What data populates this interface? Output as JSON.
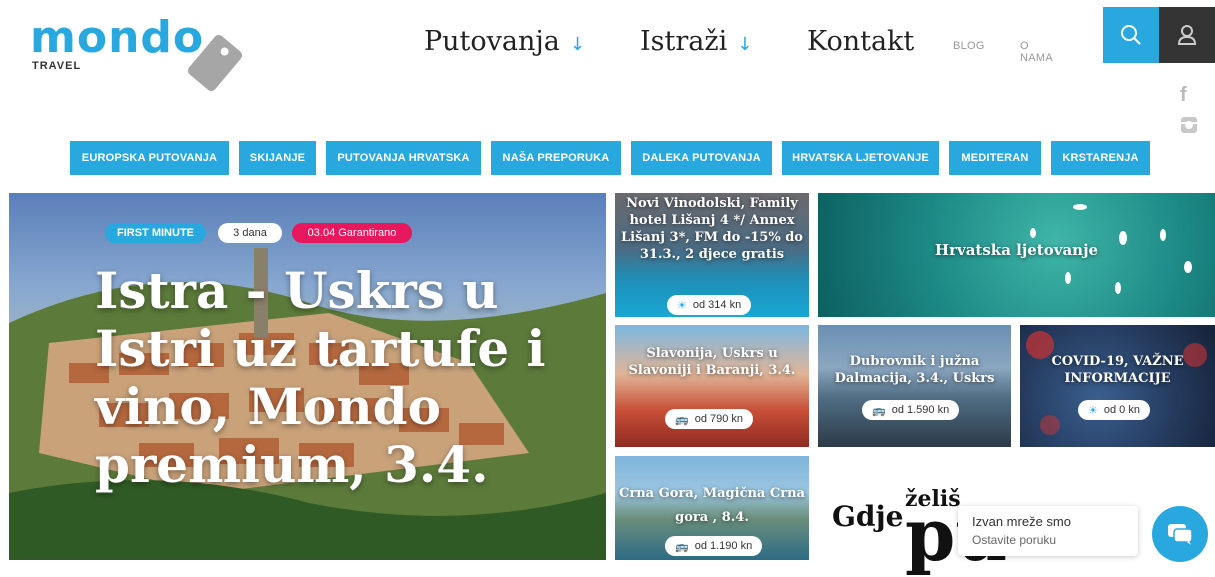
{
  "logo": {
    "word": "mondo",
    "sub": "TRAVEL"
  },
  "nav": {
    "items": [
      {
        "label": "Putovanja",
        "arrow": "↓"
      },
      {
        "label": "Istraži",
        "arrow": "↓"
      },
      {
        "label": "Kontakt"
      }
    ],
    "small": [
      "BLOG",
      "O NAMA"
    ]
  },
  "social": {
    "facebook": "f"
  },
  "categories": [
    "EUROPSKA PUTOVANJA",
    "SKIJANJE",
    "PUTOVANJA HRVATSKA",
    "NAŠA PREPORUKA",
    "DALEKA PUTOVANJA",
    "HRVATSKA LJETOVANJE",
    "MEDITERAN",
    "KRSTARENJA"
  ],
  "hero": {
    "badges": [
      "FIRST MINUTE",
      "3 dana",
      "03.04 Garantirano"
    ],
    "title": "Istra - Uskrs u Istri uz tartufe i vino, Mondo premium, 3.4."
  },
  "tiles": [
    {
      "title": "Novi Vinodolski, Family hotel Lišanj 4 */ Annex Lišanj 3*, FM do -15% do 31.3., 2 djece gratis",
      "price": "od 314 kn",
      "icon": "sun-icon"
    },
    {
      "title": "Hrvatska ljetovanje"
    },
    {
      "title": "Slavonija, Uskrs u Slavoniji i Baranji, 3.4.",
      "price": "od 790 kn",
      "icon": "bus-icon"
    },
    {
      "title": "Dubrovnik i južna Dalmacija, 3.4., Uskrs",
      "price": "od 1.590 kn",
      "icon": "bus-icon"
    },
    {
      "title": "COVID-19, VAŽNE INFORMACIJE",
      "price": "od 0 kn",
      "icon": "sun-icon"
    },
    {
      "title": "Crna Gora, Magična Crna gora , 8.4.",
      "price": "od 1.190 kn",
      "icon": "bus-icon"
    }
  ],
  "promo": {
    "gdje": "Gdje",
    "zelis": "želiš",
    "big": "pu"
  },
  "chat": {
    "line1": "Izvan mreže smo",
    "line2": "Ostavite poruku"
  },
  "colors": {
    "accent": "#29a8e0",
    "pink": "#e8185f",
    "dark": "#333333"
  }
}
